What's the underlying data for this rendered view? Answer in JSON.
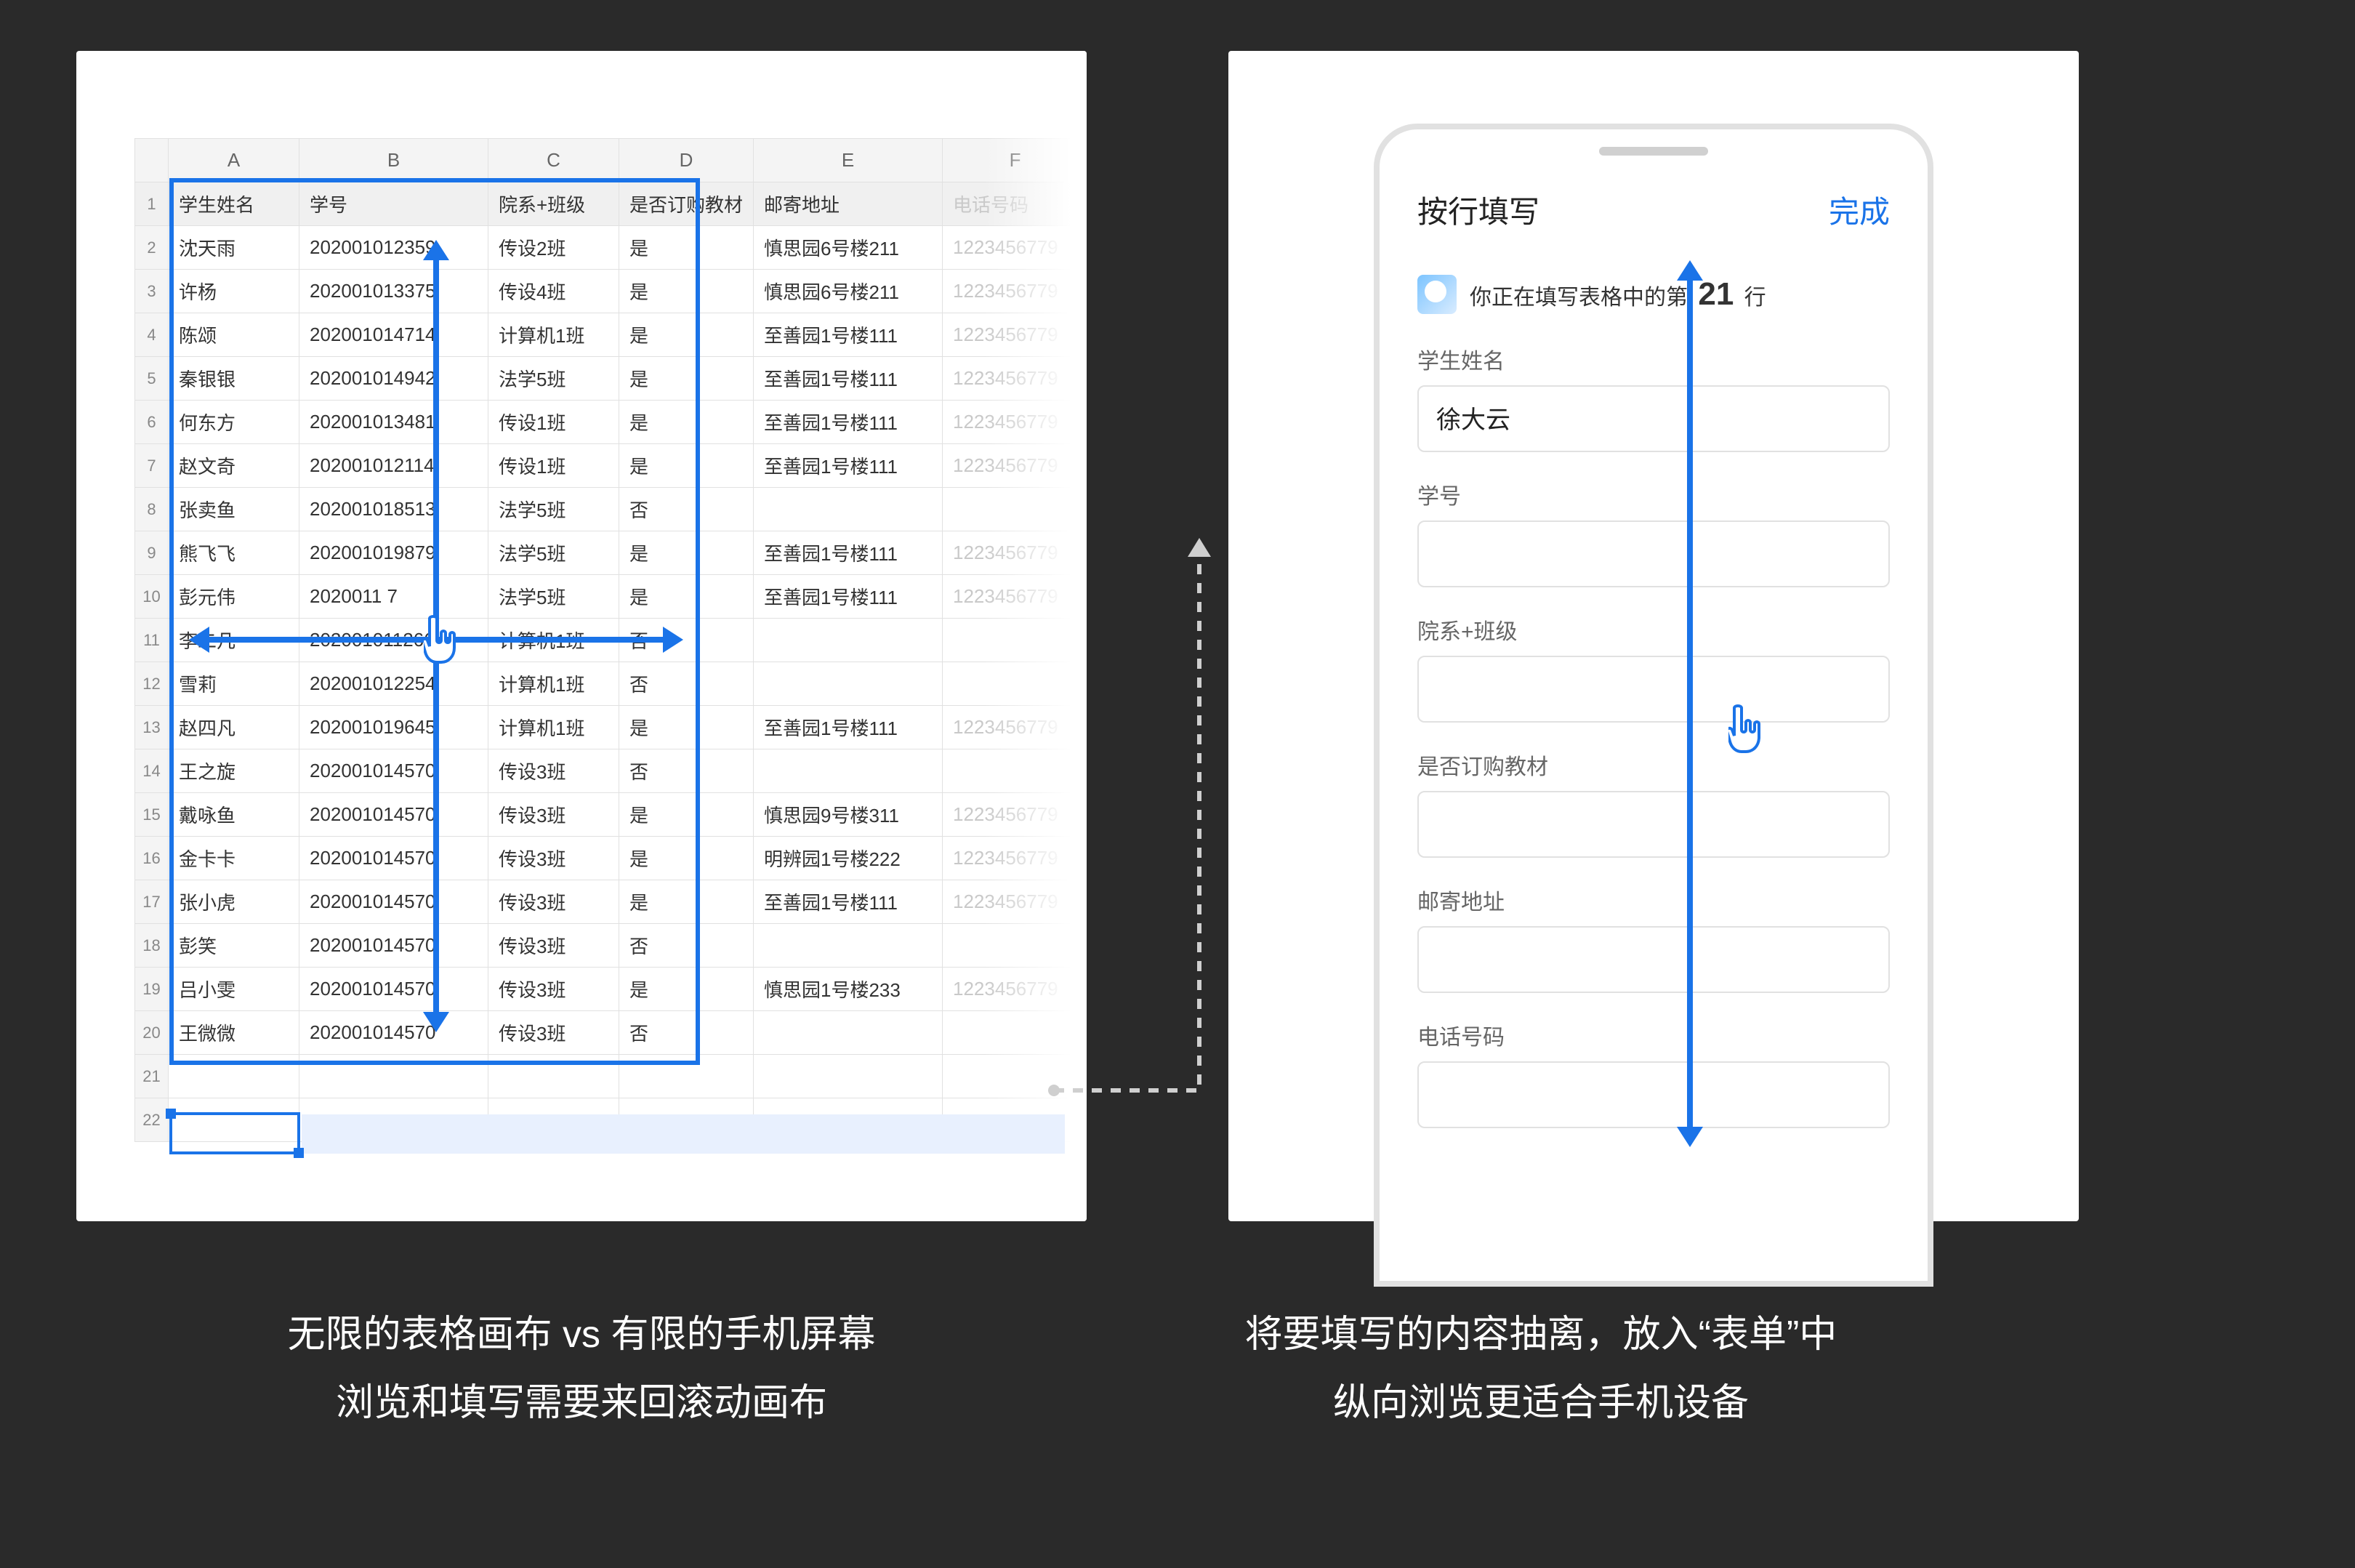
{
  "colors": {
    "accent": "#1a73e8",
    "background": "#2a2a2a"
  },
  "spreadsheet": {
    "column_letters": [
      "A",
      "B",
      "C",
      "D",
      "E",
      "F"
    ],
    "headers": [
      "学生姓名",
      "学号",
      "院系+班级",
      "是否订购教材",
      "邮寄地址",
      "电话号码"
    ],
    "rows": [
      {
        "n": 1,
        "name": "沈天雨",
        "id": "202001012359",
        "class": "传设2班",
        "buy": "是",
        "addr": "慎思园6号楼211",
        "tel": "1223456779"
      },
      {
        "n": 2,
        "name": "许杨",
        "id": "202001013375",
        "class": "传设4班",
        "buy": "是",
        "addr": "慎思园6号楼211",
        "tel": "1223456779"
      },
      {
        "n": 3,
        "name": "陈颂",
        "id": "202001014714",
        "class": "计算机1班",
        "buy": "是",
        "addr": "至善园1号楼111",
        "tel": "1223456779"
      },
      {
        "n": 4,
        "name": "秦银银",
        "id": "202001014942",
        "class": "法学5班",
        "buy": "是",
        "addr": "至善园1号楼111",
        "tel": "1223456779"
      },
      {
        "n": 5,
        "name": "何东方",
        "id": "202001013481",
        "class": "传设1班",
        "buy": "是",
        "addr": "至善园1号楼111",
        "tel": "1223456779"
      },
      {
        "n": 6,
        "name": "赵文奇",
        "id": "202001012114",
        "class": "传设1班",
        "buy": "是",
        "addr": "至善园1号楼111",
        "tel": "1223456779"
      },
      {
        "n": 7,
        "name": "张卖鱼",
        "id": "202001018513",
        "class": "法学5班",
        "buy": "否",
        "addr": "",
        "tel": ""
      },
      {
        "n": 8,
        "name": "熊飞飞",
        "id": "202001019879",
        "class": "法学5班",
        "buy": "是",
        "addr": "至善园1号楼111",
        "tel": "1223456779"
      },
      {
        "n": 9,
        "name": "彭元伟",
        "id": "2020011   7",
        "class": "法学5班",
        "buy": "是",
        "addr": "至善园1号楼111",
        "tel": "1223456779"
      },
      {
        "n": 10,
        "name": "李二凡",
        "id": "202001011266",
        "class": "计算机1班",
        "buy": "否",
        "addr": "",
        "tel": ""
      },
      {
        "n": 11,
        "name": "雪莉",
        "id": "202001012254",
        "class": "计算机1班",
        "buy": "否",
        "addr": "",
        "tel": ""
      },
      {
        "n": 12,
        "name": "赵四凡",
        "id": "202001019645",
        "class": "计算机1班",
        "buy": "是",
        "addr": "至善园1号楼111",
        "tel": "1223456779"
      },
      {
        "n": 13,
        "name": "王之旋",
        "id": "202001014570",
        "class": "传设3班",
        "buy": "否",
        "addr": "",
        "tel": ""
      },
      {
        "n": 14,
        "name": "戴咏鱼",
        "id": "202001014570",
        "class": "传设3班",
        "buy": "是",
        "addr": "慎思园9号楼311",
        "tel": "1223456779"
      },
      {
        "n": 15,
        "name": "金卡卡",
        "id": "202001014570",
        "class": "传设3班",
        "buy": "是",
        "addr": "明辨园1号楼222",
        "tel": "1223456779"
      },
      {
        "n": 16,
        "name": "张小虎",
        "id": "202001014570",
        "class": "传设3班",
        "buy": "是",
        "addr": "至善园1号楼111",
        "tel": "1223456779"
      },
      {
        "n": 17,
        "name": "彭笑",
        "id": "202001014570",
        "class": "传设3班",
        "buy": "否",
        "addr": "",
        "tel": ""
      },
      {
        "n": 18,
        "name": "吕小雯",
        "id": "202001014570",
        "class": "传设3班",
        "buy": "是",
        "addr": "慎思园1号楼233",
        "tel": "1223456779"
      },
      {
        "n": 19,
        "name": "王微微",
        "id": "202001014570",
        "class": "传设3班",
        "buy": "否",
        "addr": "",
        "tel": ""
      }
    ],
    "empty_rows": [
      21,
      22
    ],
    "selected_row_number": 21
  },
  "mobile_form": {
    "title": "按行填写",
    "done_label": "完成",
    "banner_prefix": "你正在填写表格中的第",
    "banner_row": "21",
    "banner_suffix": "行",
    "fields": [
      {
        "label": "学生姓名",
        "value": "徐大云"
      },
      {
        "label": "学号",
        "value": ""
      },
      {
        "label": "院系+班级",
        "value": ""
      },
      {
        "label": "是否订购教材",
        "value": ""
      },
      {
        "label": "邮寄地址",
        "value": ""
      },
      {
        "label": "电话号码",
        "value": ""
      }
    ]
  },
  "captions": {
    "left_line1": "无限的表格画布 vs 有限的手机屏幕",
    "left_line2": "浏览和填写需要来回滚动画布",
    "right_line1": "将要填写的内容抽离，放入“表单”中",
    "right_line2": "纵向浏览更适合手机设备"
  }
}
